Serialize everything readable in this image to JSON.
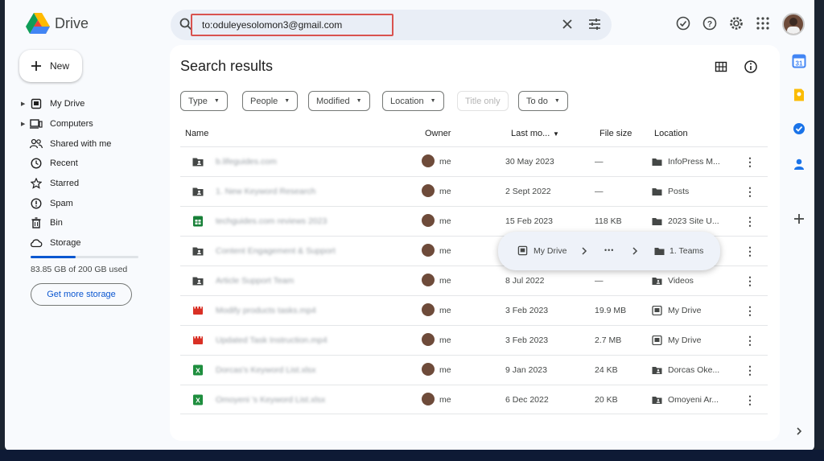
{
  "app": {
    "name": "Drive"
  },
  "search": {
    "query": "to:oduleyesolomon3@gmail.com"
  },
  "new_button": {
    "label": "New"
  },
  "nav": {
    "items": [
      {
        "label": "My Drive",
        "icon": "my-drive-icon",
        "expandable": true
      },
      {
        "label": "Computers",
        "icon": "computer-icon",
        "expandable": true
      },
      {
        "label": "Shared with me",
        "icon": "people-icon",
        "expandable": false
      },
      {
        "label": "Recent",
        "icon": "clock-icon",
        "expandable": false
      },
      {
        "label": "Starred",
        "icon": "star-icon",
        "expandable": false
      },
      {
        "label": "Spam",
        "icon": "spam-icon",
        "expandable": false
      },
      {
        "label": "Bin",
        "icon": "bin-icon",
        "expandable": false
      },
      {
        "label": "Storage",
        "icon": "cloud-icon",
        "expandable": false
      }
    ],
    "storage_used_fraction": 0.42,
    "storage_text": "83.85 GB of 200 GB used",
    "get_storage_label": "Get more storage"
  },
  "main": {
    "title": "Search results",
    "filters": {
      "type": "Type",
      "people": "People",
      "modified": "Modified",
      "location": "Location",
      "title_only": "Title only",
      "todo": "To do"
    },
    "columns": {
      "name": "Name",
      "owner": "Owner",
      "last_modified": "Last mo...",
      "file_size": "File size",
      "location": "Location"
    },
    "rows": [
      {
        "type": "shared-folder",
        "name": "b.lifeguides.com",
        "owner": "me",
        "modified": "30 May 2023",
        "size": "—",
        "location": "InfoPress M...",
        "loc_icon": "folder-icon"
      },
      {
        "type": "shared-folder",
        "name": "1. New Keyword Research",
        "owner": "me",
        "modified": "2 Sept 2022",
        "size": "—",
        "location": "Posts",
        "loc_icon": "folder-icon"
      },
      {
        "type": "sheet",
        "name": "techguides.com reviews 2023",
        "owner": "me",
        "modified": "15 Feb 2023",
        "size": "118 KB",
        "location": "2023 Site U...",
        "loc_icon": "folder-icon"
      },
      {
        "type": "shared-folder",
        "name": "Content Engagement & Support",
        "owner": "me",
        "modified": "",
        "size": "",
        "location": "",
        "loc_icon": ""
      },
      {
        "type": "shared-folder",
        "name": "Article Support Team",
        "owner": "me",
        "modified": "8 Jul 2022",
        "size": "—",
        "location": "Videos",
        "loc_icon": "shared-folder-icon"
      },
      {
        "type": "video",
        "name": "Modify products tasks.mp4",
        "owner": "me",
        "modified": "3 Feb 2023",
        "size": "19.9 MB",
        "location": "My Drive",
        "loc_icon": "my-drive-icon"
      },
      {
        "type": "video",
        "name": "Updated Task Instruction.mp4",
        "owner": "me",
        "modified": "3 Feb 2023",
        "size": "2.7 MB",
        "location": "My Drive",
        "loc_icon": "my-drive-icon"
      },
      {
        "type": "excel",
        "name": "Dorcas's Keyword List.xlsx",
        "owner": "me",
        "modified": "9 Jan 2023",
        "size": "24 KB",
        "location": "Dorcas Oke...",
        "loc_icon": "shared-folder-icon"
      },
      {
        "type": "excel",
        "name": "Omoyeni 's Keyword List.xlsx",
        "owner": "me",
        "modified": "6 Dec 2022",
        "size": "20 KB",
        "location": "Omoyeni Ar...",
        "loc_icon": "shared-folder-icon"
      }
    ]
  },
  "path_popover": {
    "root": "My Drive",
    "ellipsis": "•••",
    "leaf": "1. Teams"
  },
  "colors": {
    "accent": "#0b57d0",
    "highlight_box": "#d9534f",
    "sheet": "#188038",
    "video": "#d93025"
  }
}
